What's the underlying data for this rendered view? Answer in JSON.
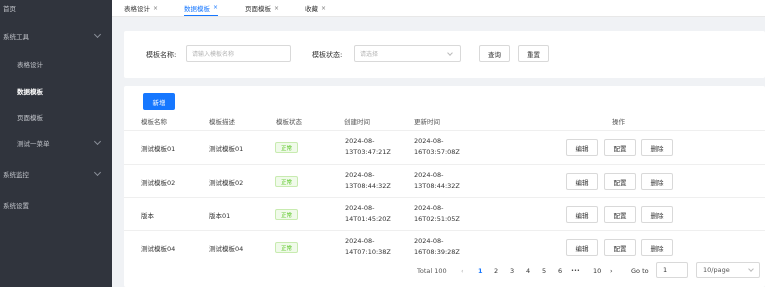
{
  "sidebar": {
    "items": [
      {
        "label": "首页"
      },
      {
        "label": "系统工具"
      },
      {
        "label": "表格设计"
      },
      {
        "label": "数据模板"
      },
      {
        "label": "页面模板"
      },
      {
        "label": "测试一菜单"
      },
      {
        "label": "系统监控"
      },
      {
        "label": "系统设置"
      }
    ]
  },
  "tabs": [
    {
      "label": "表格设计",
      "close": "×"
    },
    {
      "label": "数据模板",
      "close": "×"
    },
    {
      "label": "页面模板",
      "close": "×"
    },
    {
      "label": "收藏",
      "close": "×"
    }
  ],
  "search": {
    "name_label": "模板名称:",
    "name_placeholder": "请输入模板名称",
    "status_label": "模板状态:",
    "status_placeholder": "请选择",
    "query_button": "查询",
    "reset_button": "重置"
  },
  "table": {
    "new_button": "新增",
    "headers": [
      "模板名称",
      "模板描述",
      "模板状态",
      "创建时间",
      "更新时间",
      "操作"
    ],
    "rows": [
      {
        "name": "测试模板01",
        "desc": "测试模板01",
        "status": "正常",
        "created_date": "2024-08-",
        "created_time": "13T03:47:21Z",
        "updated_date": "2024-08-",
        "updated_time": "16T03:57:08Z"
      },
      {
        "name": "测试模板02",
        "desc": "测试模板02",
        "status": "正常",
        "created_date": "2024-08-",
        "created_time": "13T08:44:32Z",
        "updated_date": "2024-08-",
        "updated_time": "13T08:44:32Z"
      },
      {
        "name": "版本",
        "desc": "版本01",
        "status": "正常",
        "created_date": "2024-08-",
        "created_time": "14T01:45:20Z",
        "updated_date": "2024-08-",
        "updated_time": "16T02:51:05Z"
      },
      {
        "name": "测试模板04",
        "desc": "测试模板04",
        "status": "正常",
        "created_date": "2024-08-",
        "created_time": "14T07:10:38Z",
        "updated_date": "2024-08-",
        "updated_time": "16T08:39:28Z"
      }
    ],
    "actions": {
      "edit": "编辑",
      "config": "配置",
      "delete": "删除"
    }
  },
  "pagination": {
    "total": "Total 100",
    "prev": "‹",
    "pages": [
      "1",
      "2",
      "3",
      "4",
      "5",
      "6"
    ],
    "ellipsis": "•••",
    "last": "10",
    "next": "›",
    "goto_label": "Go to",
    "goto_value": "1",
    "page_size": "10/page"
  }
}
